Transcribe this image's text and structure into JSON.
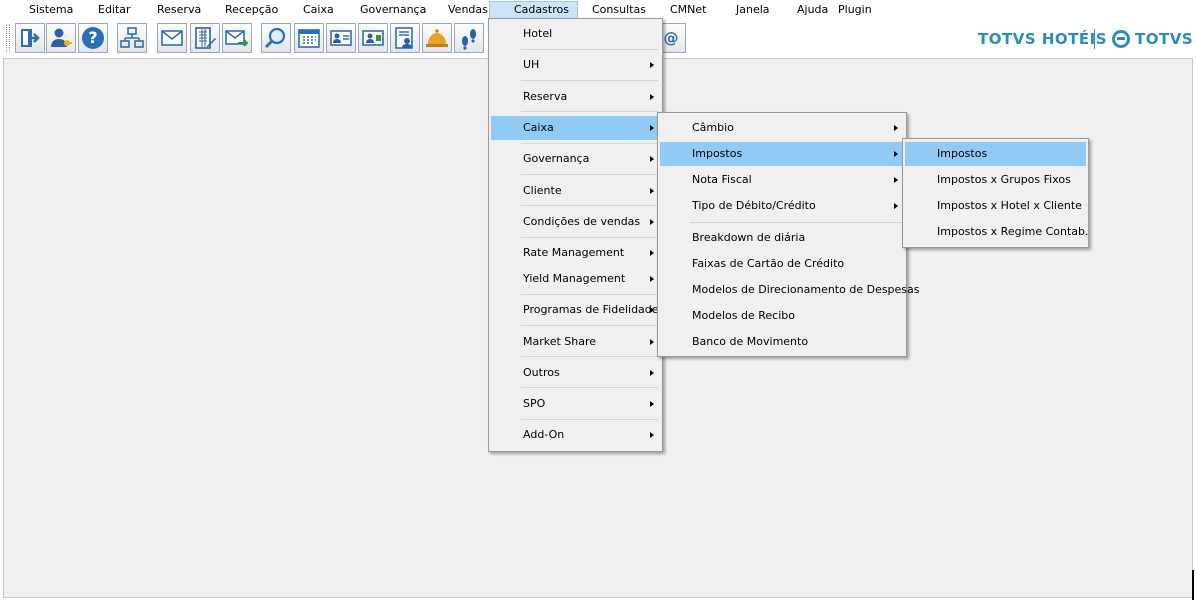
{
  "menubar": {
    "items": [
      "Sistema",
      "Editar",
      "Reserva",
      "Recepção",
      "Caixa",
      "Governança",
      "Vendas",
      "Cadastros",
      "Consultas",
      "CMNet",
      "Janela",
      "Ajuda",
      "Plugin"
    ],
    "active": "Cadastros"
  },
  "toolbar": {
    "buttons": [
      "exit-icon",
      "user-key-icon",
      "help-icon",
      "org-chart-icon",
      "mail-icon",
      "register-edit-icon",
      "mail-forward-icon",
      "search-icon",
      "calendar-icon",
      "guest-card-icon",
      "guest-card-2-icon",
      "guest-list-icon",
      "service-bell-icon",
      "footsteps-icon"
    ],
    "hidden_button_glyph": "@"
  },
  "brand": {
    "hotels": "TOTVS HOTÉIS",
    "totvs": "TOTVS",
    "color": "#2a8dbd"
  },
  "menu_cadastros": {
    "items": [
      {
        "label": "Hotel",
        "submenu": false
      },
      {
        "label": "UH",
        "submenu": true
      },
      {
        "label": "Reserva",
        "submenu": true
      },
      {
        "label": "Caixa",
        "submenu": true,
        "highlighted": true
      },
      {
        "label": "Governança",
        "submenu": true
      },
      {
        "label": "Cliente",
        "submenu": true
      },
      {
        "label": "Condições de vendas",
        "submenu": true
      },
      {
        "label": "Rate Management",
        "submenu": true
      },
      {
        "label": "Yield Management",
        "submenu": true
      },
      {
        "label": "Programas de Fidelidade",
        "submenu": true
      },
      {
        "label": "Market Share",
        "submenu": true
      },
      {
        "label": "Outros",
        "submenu": true
      },
      {
        "label": "SPO",
        "submenu": true
      },
      {
        "label": "Add-On",
        "submenu": true
      }
    ]
  },
  "menu_caixa": {
    "items": [
      {
        "label": "Câmbio",
        "submenu": true
      },
      {
        "label": "Impostos",
        "submenu": true,
        "highlighted": true
      },
      {
        "label": "Nota Fiscal",
        "submenu": true
      },
      {
        "label": "Tipo de Débito/Crédito",
        "submenu": true
      },
      {
        "label": "Breakdown de diária",
        "submenu": false
      },
      {
        "label": "Faixas de Cartão de Crédito",
        "submenu": false
      },
      {
        "label": "Modelos de Direcionamento de Despesas",
        "submenu": false
      },
      {
        "label": "Modelos de Recibo",
        "submenu": false
      },
      {
        "label": "Banco de Movimento",
        "submenu": false
      }
    ]
  },
  "menu_impostos": {
    "items": [
      {
        "label": "Impostos",
        "highlighted": true
      },
      {
        "label": "Impostos x Grupos Fixos"
      },
      {
        "label": "Impostos x Hotel x Cliente"
      },
      {
        "label": "Impostos x Regime Contab."
      }
    ]
  },
  "colors": {
    "highlight": "#91c9f7",
    "menu_bg": "#f0f0f0"
  }
}
